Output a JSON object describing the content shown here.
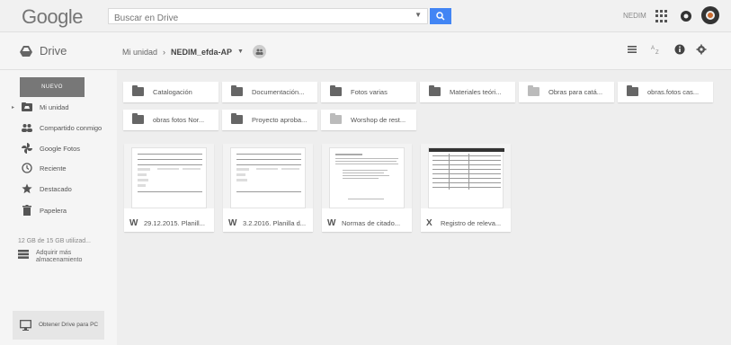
{
  "header": {
    "logo": "Google",
    "search_placeholder": "Buscar en Drive",
    "user_name": "NEDIM"
  },
  "subheader": {
    "app_title": "Drive",
    "breadcrumb": {
      "root": "Mi unidad",
      "separator": "›",
      "current": "NEDIM_efda-AP"
    }
  },
  "sidebar": {
    "new_label": "NUEVO",
    "items": [
      {
        "label": "Mi unidad",
        "icon": "folder-drive-icon"
      },
      {
        "label": "Compartido conmigo",
        "icon": "people-icon"
      },
      {
        "label": "Google Fotos",
        "icon": "pinwheel-icon"
      },
      {
        "label": "Reciente",
        "icon": "clock-icon"
      },
      {
        "label": "Destacado",
        "icon": "star-icon"
      },
      {
        "label": "Papelera",
        "icon": "trash-icon"
      }
    ],
    "storage_text": "12 GB de 15 GB utilizad...",
    "buy_storage": "Adquirir más almacenamiento",
    "get_drive": "Obtener Drive para PC"
  },
  "folders": [
    {
      "name": "Catalogación",
      "style": "dark"
    },
    {
      "name": "Documentación...",
      "style": "dark"
    },
    {
      "name": "Fotos varias",
      "style": "dark"
    },
    {
      "name": "Materiales teóri...",
      "style": "dark"
    },
    {
      "name": "Obras para catá...",
      "style": "light"
    },
    {
      "name": "obras.fotos cas...",
      "style": "dark"
    },
    {
      "name": "obras fotos Nor...",
      "style": "dark"
    },
    {
      "name": "Proyecto aproba...",
      "style": "dark"
    },
    {
      "name": "Worshop de rest...",
      "style": "light"
    }
  ],
  "files": [
    {
      "type": "W",
      "name": "29.12.2015. Planill..."
    },
    {
      "type": "W",
      "name": "3.2.2016. Planilla d..."
    },
    {
      "type": "W",
      "name": "Normas de citado..."
    },
    {
      "type": "X",
      "name": "Registro de releva..."
    }
  ],
  "colors": {
    "accent": "#4285f4",
    "new_button": "#777777",
    "folder_dark": "#666666",
    "folder_light": "#bbbbbb"
  }
}
